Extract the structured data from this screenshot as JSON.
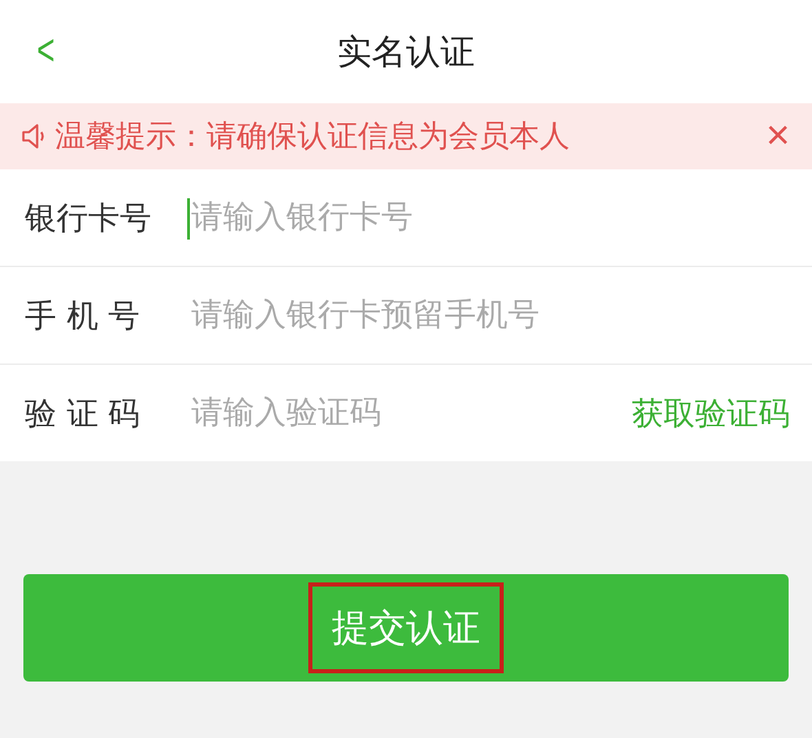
{
  "header": {
    "back": "<",
    "title": "实名认证"
  },
  "notice": {
    "text": "温馨提示：请确保认证信息为会员本人",
    "close": "×"
  },
  "fields": [
    {
      "kind": "input",
      "label": "银行卡号",
      "placeholder": "请输入银行卡号",
      "focused": true
    },
    {
      "kind": "input",
      "label": "手 机 号",
      "placeholder": "请输入银行卡预留手机号",
      "focused": false
    },
    {
      "kind": "code",
      "label": "验 证 码",
      "placeholder": "请输入验证码",
      "focused": false,
      "action": "获取验证码"
    }
  ],
  "submit": {
    "label": "提交认证",
    "highlighted": true
  }
}
